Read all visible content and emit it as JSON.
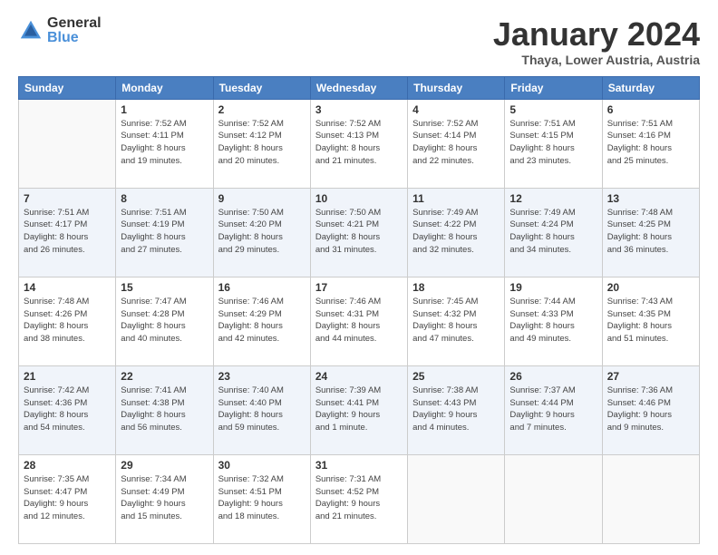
{
  "logo": {
    "general": "General",
    "blue": "Blue"
  },
  "header": {
    "month": "January 2024",
    "location": "Thaya, Lower Austria, Austria"
  },
  "weekdays": [
    "Sunday",
    "Monday",
    "Tuesday",
    "Wednesday",
    "Thursday",
    "Friday",
    "Saturday"
  ],
  "weeks": [
    [
      {
        "day": "",
        "info": ""
      },
      {
        "day": "1",
        "info": "Sunrise: 7:52 AM\nSunset: 4:11 PM\nDaylight: 8 hours\nand 19 minutes."
      },
      {
        "day": "2",
        "info": "Sunrise: 7:52 AM\nSunset: 4:12 PM\nDaylight: 8 hours\nand 20 minutes."
      },
      {
        "day": "3",
        "info": "Sunrise: 7:52 AM\nSunset: 4:13 PM\nDaylight: 8 hours\nand 21 minutes."
      },
      {
        "day": "4",
        "info": "Sunrise: 7:52 AM\nSunset: 4:14 PM\nDaylight: 8 hours\nand 22 minutes."
      },
      {
        "day": "5",
        "info": "Sunrise: 7:51 AM\nSunset: 4:15 PM\nDaylight: 8 hours\nand 23 minutes."
      },
      {
        "day": "6",
        "info": "Sunrise: 7:51 AM\nSunset: 4:16 PM\nDaylight: 8 hours\nand 25 minutes."
      }
    ],
    [
      {
        "day": "7",
        "info": "Sunrise: 7:51 AM\nSunset: 4:17 PM\nDaylight: 8 hours\nand 26 minutes."
      },
      {
        "day": "8",
        "info": "Sunrise: 7:51 AM\nSunset: 4:19 PM\nDaylight: 8 hours\nand 27 minutes."
      },
      {
        "day": "9",
        "info": "Sunrise: 7:50 AM\nSunset: 4:20 PM\nDaylight: 8 hours\nand 29 minutes."
      },
      {
        "day": "10",
        "info": "Sunrise: 7:50 AM\nSunset: 4:21 PM\nDaylight: 8 hours\nand 31 minutes."
      },
      {
        "day": "11",
        "info": "Sunrise: 7:49 AM\nSunset: 4:22 PM\nDaylight: 8 hours\nand 32 minutes."
      },
      {
        "day": "12",
        "info": "Sunrise: 7:49 AM\nSunset: 4:24 PM\nDaylight: 8 hours\nand 34 minutes."
      },
      {
        "day": "13",
        "info": "Sunrise: 7:48 AM\nSunset: 4:25 PM\nDaylight: 8 hours\nand 36 minutes."
      }
    ],
    [
      {
        "day": "14",
        "info": "Sunrise: 7:48 AM\nSunset: 4:26 PM\nDaylight: 8 hours\nand 38 minutes."
      },
      {
        "day": "15",
        "info": "Sunrise: 7:47 AM\nSunset: 4:28 PM\nDaylight: 8 hours\nand 40 minutes."
      },
      {
        "day": "16",
        "info": "Sunrise: 7:46 AM\nSunset: 4:29 PM\nDaylight: 8 hours\nand 42 minutes."
      },
      {
        "day": "17",
        "info": "Sunrise: 7:46 AM\nSunset: 4:31 PM\nDaylight: 8 hours\nand 44 minutes."
      },
      {
        "day": "18",
        "info": "Sunrise: 7:45 AM\nSunset: 4:32 PM\nDaylight: 8 hours\nand 47 minutes."
      },
      {
        "day": "19",
        "info": "Sunrise: 7:44 AM\nSunset: 4:33 PM\nDaylight: 8 hours\nand 49 minutes."
      },
      {
        "day": "20",
        "info": "Sunrise: 7:43 AM\nSunset: 4:35 PM\nDaylight: 8 hours\nand 51 minutes."
      }
    ],
    [
      {
        "day": "21",
        "info": "Sunrise: 7:42 AM\nSunset: 4:36 PM\nDaylight: 8 hours\nand 54 minutes."
      },
      {
        "day": "22",
        "info": "Sunrise: 7:41 AM\nSunset: 4:38 PM\nDaylight: 8 hours\nand 56 minutes."
      },
      {
        "day": "23",
        "info": "Sunrise: 7:40 AM\nSunset: 4:40 PM\nDaylight: 8 hours\nand 59 minutes."
      },
      {
        "day": "24",
        "info": "Sunrise: 7:39 AM\nSunset: 4:41 PM\nDaylight: 9 hours\nand 1 minute."
      },
      {
        "day": "25",
        "info": "Sunrise: 7:38 AM\nSunset: 4:43 PM\nDaylight: 9 hours\nand 4 minutes."
      },
      {
        "day": "26",
        "info": "Sunrise: 7:37 AM\nSunset: 4:44 PM\nDaylight: 9 hours\nand 7 minutes."
      },
      {
        "day": "27",
        "info": "Sunrise: 7:36 AM\nSunset: 4:46 PM\nDaylight: 9 hours\nand 9 minutes."
      }
    ],
    [
      {
        "day": "28",
        "info": "Sunrise: 7:35 AM\nSunset: 4:47 PM\nDaylight: 9 hours\nand 12 minutes."
      },
      {
        "day": "29",
        "info": "Sunrise: 7:34 AM\nSunset: 4:49 PM\nDaylight: 9 hours\nand 15 minutes."
      },
      {
        "day": "30",
        "info": "Sunrise: 7:32 AM\nSunset: 4:51 PM\nDaylight: 9 hours\nand 18 minutes."
      },
      {
        "day": "31",
        "info": "Sunrise: 7:31 AM\nSunset: 4:52 PM\nDaylight: 9 hours\nand 21 minutes."
      },
      {
        "day": "",
        "info": ""
      },
      {
        "day": "",
        "info": ""
      },
      {
        "day": "",
        "info": ""
      }
    ]
  ]
}
